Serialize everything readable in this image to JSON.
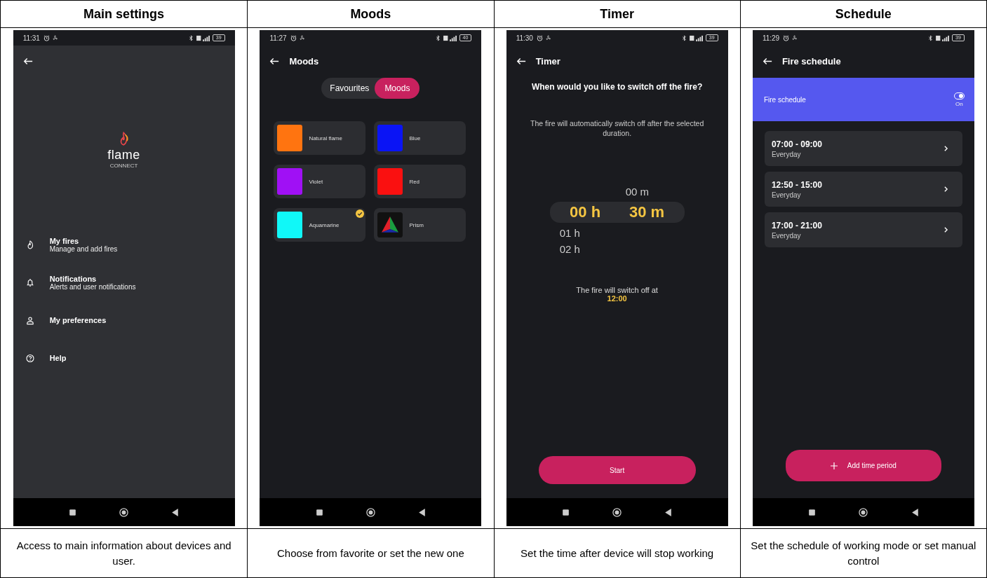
{
  "columns": [
    {
      "heading": "Main settings",
      "caption": "Access to main information about devices and user.",
      "screen": {
        "kind": "menu",
        "status": {
          "time": "11:31",
          "battery": "39"
        },
        "logo": {
          "name": "flame",
          "tagline": "CONNECT"
        },
        "items": [
          {
            "title": "My fires",
            "subtitle": "Manage and add fires"
          },
          {
            "title": "Notifications",
            "subtitle": "Alerts and user notifications"
          },
          {
            "title": "My preferences"
          },
          {
            "title": "Help"
          }
        ]
      }
    },
    {
      "heading": "Moods",
      "caption": "Choose from favorite or set the new one",
      "screen": {
        "kind": "moods",
        "status": {
          "time": "11:27",
          "battery": "40"
        },
        "title": "Moods",
        "segments": [
          {
            "label": "Favourites",
            "selected": false
          },
          {
            "label": "Moods",
            "selected": true
          }
        ],
        "moods": [
          {
            "kind": "swatch",
            "name": "Natural flame",
            "color": "#ff7410",
            "checked": false
          },
          {
            "kind": "swatch",
            "name": "Blue",
            "color": "#0a14f5",
            "checked": false
          },
          {
            "kind": "swatch",
            "name": "Violet",
            "color": "#a010f5",
            "checked": false
          },
          {
            "kind": "swatch",
            "name": "Red",
            "color": "#fa1010",
            "checked": false
          },
          {
            "kind": "swatch",
            "name": "Aquamarine",
            "color": "#10f8f8",
            "checked": true
          },
          {
            "kind": "prism",
            "name": "Prism",
            "checked": false
          }
        ]
      }
    },
    {
      "heading": "Timer",
      "caption": "Set the time after device will stop working",
      "screen": {
        "kind": "timer",
        "status": {
          "time": "11:30",
          "battery": "39"
        },
        "title": "Timer",
        "question": "When would you like to switch off the fire?",
        "description": "The fire will automatically switch off after the selected duration.",
        "picker": {
          "minutes_above": "00 m",
          "hours": "00 h",
          "minutes": "30 m",
          "hours_below": [
            "01 h",
            "02 h"
          ]
        },
        "end_label": "The fire will switch off at",
        "end_time": "12:00",
        "button": "Start"
      }
    },
    {
      "heading": "Schedule",
      "caption": "Set the schedule of working mode or set manual control",
      "screen": {
        "kind": "schedule",
        "status": {
          "time": "11:29",
          "battery": "39"
        },
        "title": "Fire schedule",
        "banner": {
          "label": "Fire schedule",
          "on": true,
          "state_label": "On"
        },
        "periods": [
          {
            "time": "07:00 - 09:00",
            "days": "Everyday"
          },
          {
            "time": "12:50 - 15:00",
            "days": "Everyday"
          },
          {
            "time": "17:00 - 21:00",
            "days": "Everyday"
          }
        ],
        "button": "Add time period"
      }
    }
  ]
}
